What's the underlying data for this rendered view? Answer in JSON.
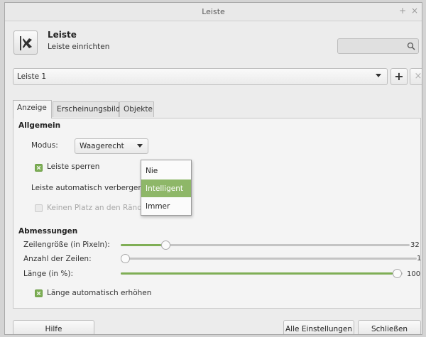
{
  "window": {
    "title": "Leiste",
    "pin_glyph": "+",
    "close_glyph": "×"
  },
  "header": {
    "title": "Leiste",
    "subtitle": "Leiste einrichten",
    "icon": "panel-settings-icon"
  },
  "search": {
    "placeholder": "",
    "icon": "search-icon"
  },
  "panel_select": {
    "value": "Leiste 1"
  },
  "panel_buttons": {
    "add": "+",
    "remove": "×"
  },
  "tabs": [
    {
      "label": "Anzeige",
      "active": true
    },
    {
      "label": "Erscheinungsbild",
      "active": false
    },
    {
      "label": "Objekte",
      "active": false
    }
  ],
  "general": {
    "heading": "Allgemein",
    "mode_label": "Modus:",
    "mode_value": "Waagerecht",
    "lock_label": "Leiste sperren",
    "lock_checked": true,
    "autohide_label": "Leiste automatisch verbergen:",
    "reserve_label": "Keinen Platz an den Rändern",
    "reserve_checked": false
  },
  "autohide_menu": {
    "options": [
      "Nie",
      "Intelligent",
      "Immer"
    ],
    "selected": "Intelligent"
  },
  "dimensions": {
    "heading": "Abmessungen",
    "row_size": {
      "label": "Zeilengröße (in Pixeln):",
      "value": "32",
      "min": 16,
      "max": 128
    },
    "rows": {
      "label": "Anzahl der Zeilen:",
      "value": "1",
      "min": 1,
      "max": 6
    },
    "length": {
      "label": "Länge (in %):",
      "value": "100",
      "min": 1,
      "max": 100
    },
    "auto_length_label": "Länge automatisch erhöhen",
    "auto_length_checked": true
  },
  "footer": {
    "help": "Hilfe",
    "all_settings": "Alle Einstellungen",
    "close": "Schließen"
  },
  "colors": {
    "accent": "#8eb768",
    "check": "#7dae55",
    "window_bg": "#ececec"
  }
}
